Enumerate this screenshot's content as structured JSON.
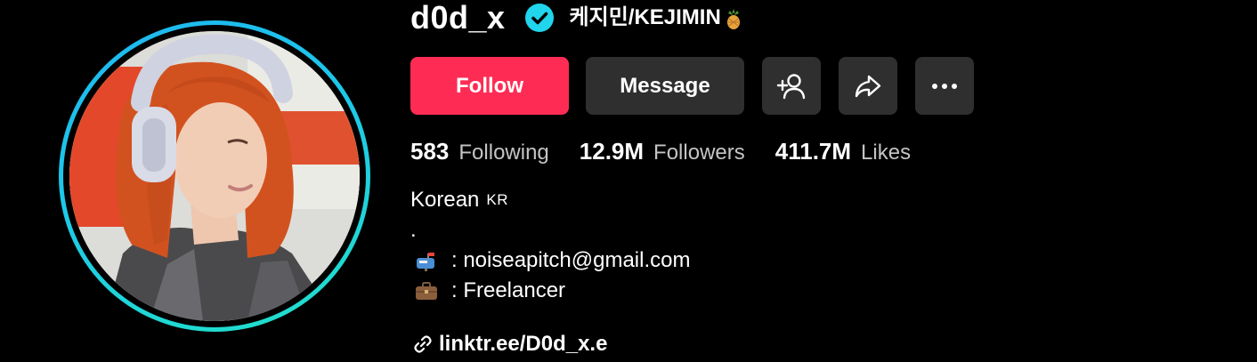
{
  "profile": {
    "username": "d0d_x",
    "nickname": "케지민/KEJIMIN",
    "verified": true,
    "accent_ring": "#1fc5e8"
  },
  "actions": {
    "follow_label": "Follow",
    "message_label": "Message",
    "add_friend_icon": "add-user-icon",
    "share_icon": "share-icon",
    "more_icon": "more-icon",
    "follow_color": "#fe2c55"
  },
  "stats": [
    {
      "value": "583",
      "label": "Following"
    },
    {
      "value": "12.9M",
      "label": "Followers"
    },
    {
      "value": "411.7M",
      "label": "Likes"
    }
  ],
  "bio": {
    "line1": "Korean",
    "flag": "KR",
    "line2": ".",
    "contact": ": noiseapitch@gmail.com",
    "contact_icon": "mailbox-icon",
    "job": ": Freelancer",
    "job_icon": "briefcase-icon"
  },
  "link": {
    "text": "linktr.ee/D0d_x.e",
    "icon": "link-icon"
  }
}
